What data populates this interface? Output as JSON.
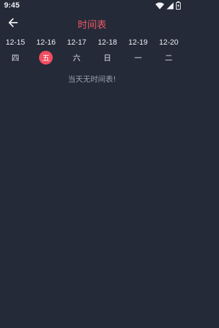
{
  "status_bar": {
    "time": "9:45",
    "icons": [
      "wifi-icon",
      "signal-icon",
      "battery-icon"
    ]
  },
  "toolbar": {
    "back_icon": "arrow-left-icon",
    "title": "时间表",
    "title_color": "#f05a69"
  },
  "days": [
    {
      "date": "12-15",
      "weekday": "四",
      "selected": false
    },
    {
      "date": "12-16",
      "weekday": "五",
      "selected": true
    },
    {
      "date": "12-17",
      "weekday": "六",
      "selected": false
    },
    {
      "date": "12-18",
      "weekday": "日",
      "selected": false
    },
    {
      "date": "12-19",
      "weekday": "一",
      "selected": false
    },
    {
      "date": "12-20",
      "weekday": "二",
      "selected": false
    }
  ],
  "empty_message": "当天无时间表!",
  "colors": {
    "background": "#252a38",
    "accent": "#f04d61",
    "text": "#f1f3f7",
    "muted": "#9aa0ab"
  }
}
